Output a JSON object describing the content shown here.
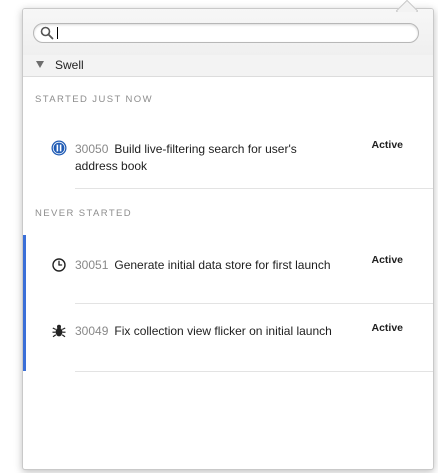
{
  "search": {
    "placeholder": "",
    "value": ""
  },
  "group": {
    "name": "Swell",
    "icon": "disclosure-triangle-down-icon"
  },
  "sections": [
    {
      "title": "STARTED JUST NOW",
      "tasks": [
        {
          "number": "30050",
          "title": "Build live-filtering search for user's address book",
          "status": "Active",
          "icon": "pause-icon",
          "icon_color": "#1f5bb5",
          "selected": false
        }
      ]
    },
    {
      "title": "NEVER STARTED",
      "tasks": [
        {
          "number": "30051",
          "title": "Generate initial data store for first launch",
          "status": "Active",
          "icon": "clock-icon",
          "selected": true
        },
        {
          "number": "30049",
          "title": "Fix collection view flicker on initial launch",
          "status": "Active",
          "icon": "bug-icon",
          "selected": true
        }
      ]
    }
  ],
  "colors": {
    "accent": "#3a6fd8",
    "pause_icon": "#1f5bb5",
    "section_title": "#8d8d8d",
    "task_number": "#888888"
  }
}
